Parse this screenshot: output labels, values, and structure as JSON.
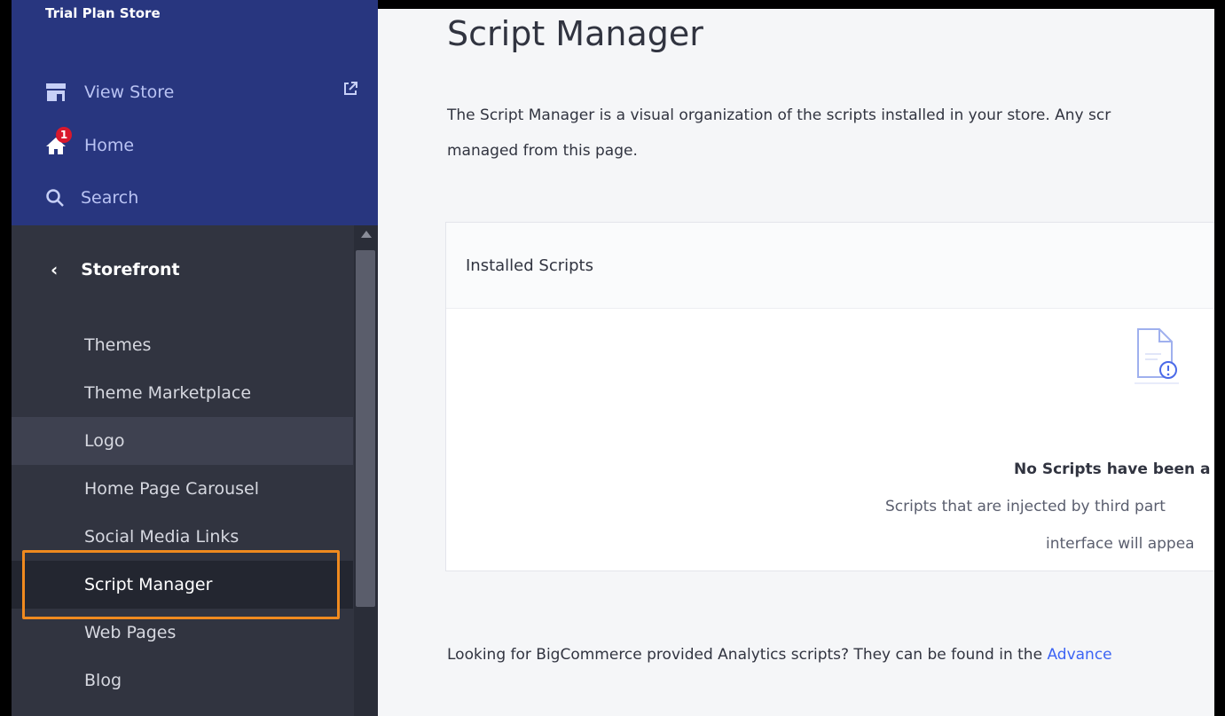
{
  "sidebar": {
    "store_name": "Trial Plan Store",
    "top_items": [
      {
        "label": "View Store",
        "icon": "storefront-icon"
      },
      {
        "label": "Home",
        "icon": "home-icon",
        "badge": "1"
      },
      {
        "label": "Search",
        "icon": "search-icon"
      }
    ],
    "external_icon": "external-link-icon",
    "section_title": "Storefront",
    "nav_items": [
      {
        "label": "Themes"
      },
      {
        "label": "Theme Marketplace"
      },
      {
        "label": "Logo"
      },
      {
        "label": "Home Page Carousel"
      },
      {
        "label": "Social Media Links"
      },
      {
        "label": "Script Manager"
      },
      {
        "label": "Web Pages"
      },
      {
        "label": "Blog"
      }
    ]
  },
  "main": {
    "title": "Script Manager",
    "description": "The Script Manager is a visual organization of the scripts installed in your store. Any scr managed from this page.",
    "description_line1": "The Script Manager is a visual organization of the scripts installed in your store. Any scr",
    "description_line2": "managed from this page.",
    "card": {
      "header": "Installed Scripts",
      "empty_title": "No Scripts have been a",
      "empty_line1": "Scripts that are injected by third part",
      "empty_line2": "interface will appea"
    },
    "footer_text": "Looking for BigCommerce provided Analytics scripts? They can be found in the ",
    "footer_link": "Advance"
  },
  "colors": {
    "sidebar_top": "#28367f",
    "sidebar": "#313440",
    "highlight": "#f08a1f",
    "badge": "#d9182c",
    "link": "#3c64f4"
  }
}
